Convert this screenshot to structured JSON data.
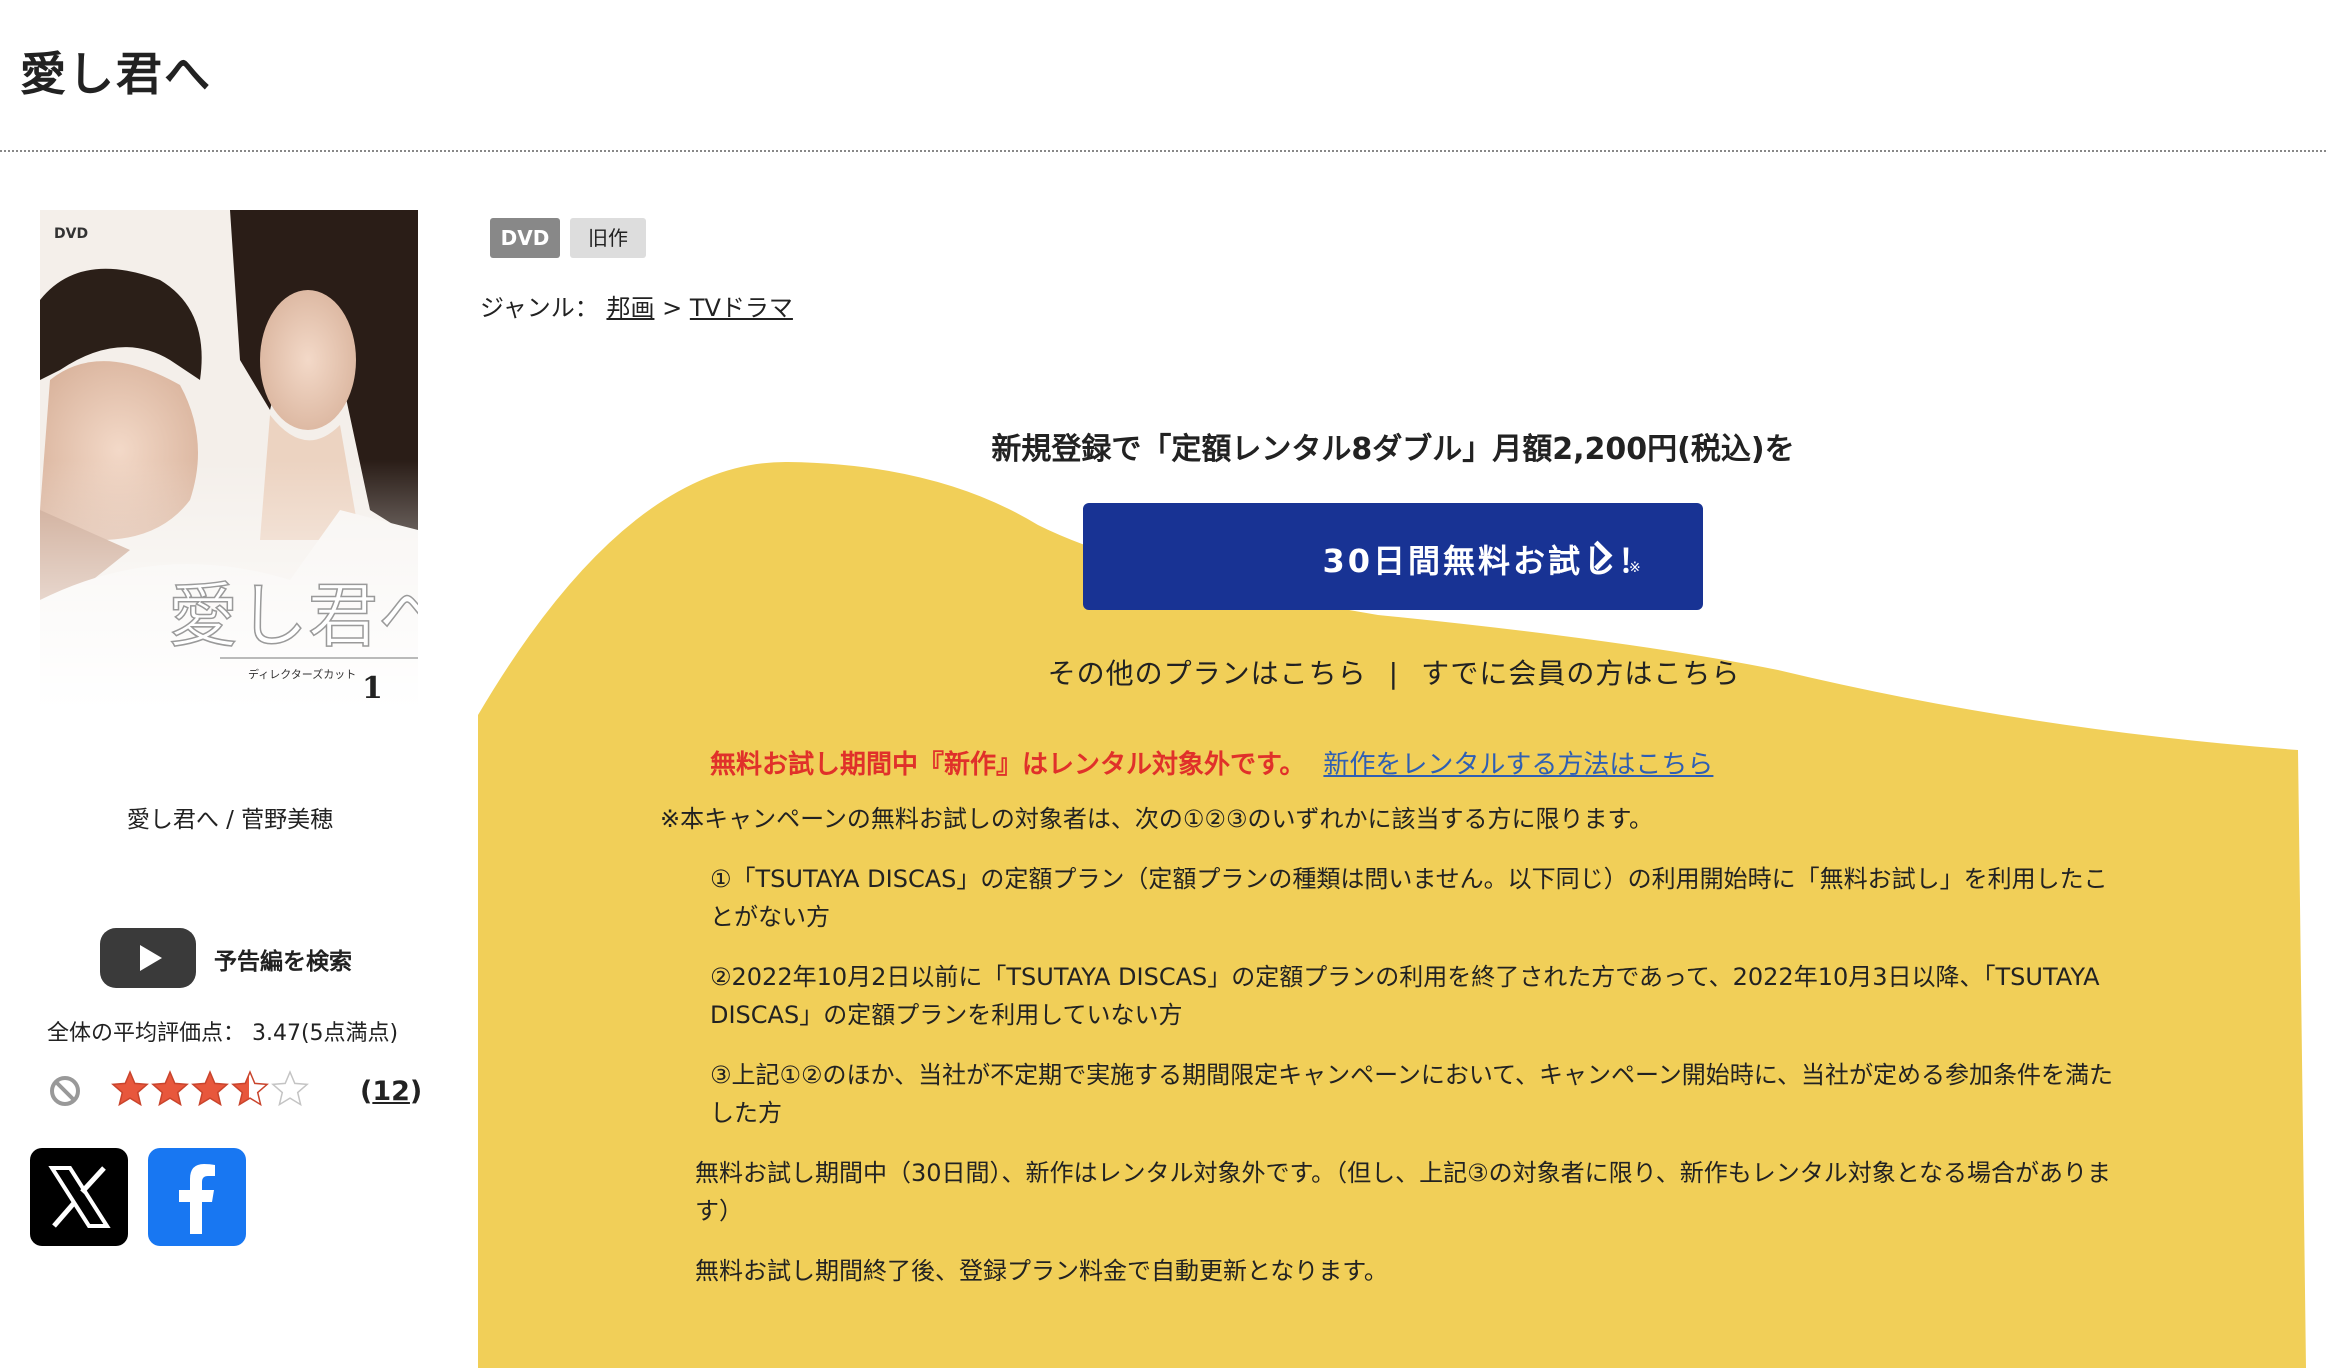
{
  "header": {
    "title": "愛し君へ"
  },
  "cover": {
    "dvd_mark": "DVD",
    "title_art": "愛し君へ",
    "subtitle_art": "ディレクターズカット",
    "volume": "1"
  },
  "sidebar": {
    "caption": "愛し君へ / 菅野美穂",
    "trailer_label": "予告編を検索",
    "avg_rating_text": "全体の平均評価点： 3.47(5点満点)",
    "rating_value": 3.47,
    "rating_max": 5,
    "review_count": "12",
    "review_count_display_open": "(",
    "review_count_display_close": ")"
  },
  "tags": {
    "format": "DVD",
    "status": "旧作"
  },
  "genre": {
    "label": "ジャンル：",
    "crumbs": [
      "邦画",
      "TVドラマ"
    ],
    "separator": ">"
  },
  "promo": {
    "headline": "新規登録で「定額レンタル8ダブル」月額2,200円(税込)を",
    "cta_label": "30日間無料お試し！",
    "cta_note": "※",
    "other_plans_link": "その他のプランはこちら",
    "divider": "|",
    "member_link": "すでに会員の方はこちら",
    "warning": "無料お試し期間中『新作』はレンタル対象外です。",
    "new_release_link": "新作をレンタルする方法はこちら",
    "notice": "※本キャンペーンの無料お試しの対象者は、次の①②③のいずれかに該当する方に限ります。",
    "condition_1": "①「TSUTAYA DISCAS」の定額プラン（定額プランの種類は問いません。以下同じ）の利用開始時に「無料お試し」を利用したことがない方",
    "condition_2": "②2022年10月2日以前に「TSUTAYA DISCAS」の定額プランの利用を終了された方であって、2022年10月3日以降、「TSUTAYA DISCAS」の定額プランを利用していない方",
    "condition_3": "③上記①②のほか、当社が不定期で実施する期間限定キャンペーンにおいて、キャンペーン開始時に、当社が定める参加条件を満たした方",
    "trial_note": "無料お試し期間中（30日間）、新作はレンタル対象外です。（但し、上記③の対象者に限り、新作もレンタル対象となる場合があります）",
    "renew_note": "無料お試し期間終了後、登録プラン料金で自動更新となります。"
  },
  "colors": {
    "promo_bg": "#f1cf58",
    "cta_bg": "#183394",
    "warning": "#e0312a",
    "link": "#2f5fb3",
    "star": "#e8573c",
    "facebook": "#1877f2"
  },
  "icons": [
    "play-icon",
    "no-entry-icon",
    "x-logo-icon",
    "facebook-logo-icon",
    "chevron-right-icon",
    "star-icon"
  ]
}
